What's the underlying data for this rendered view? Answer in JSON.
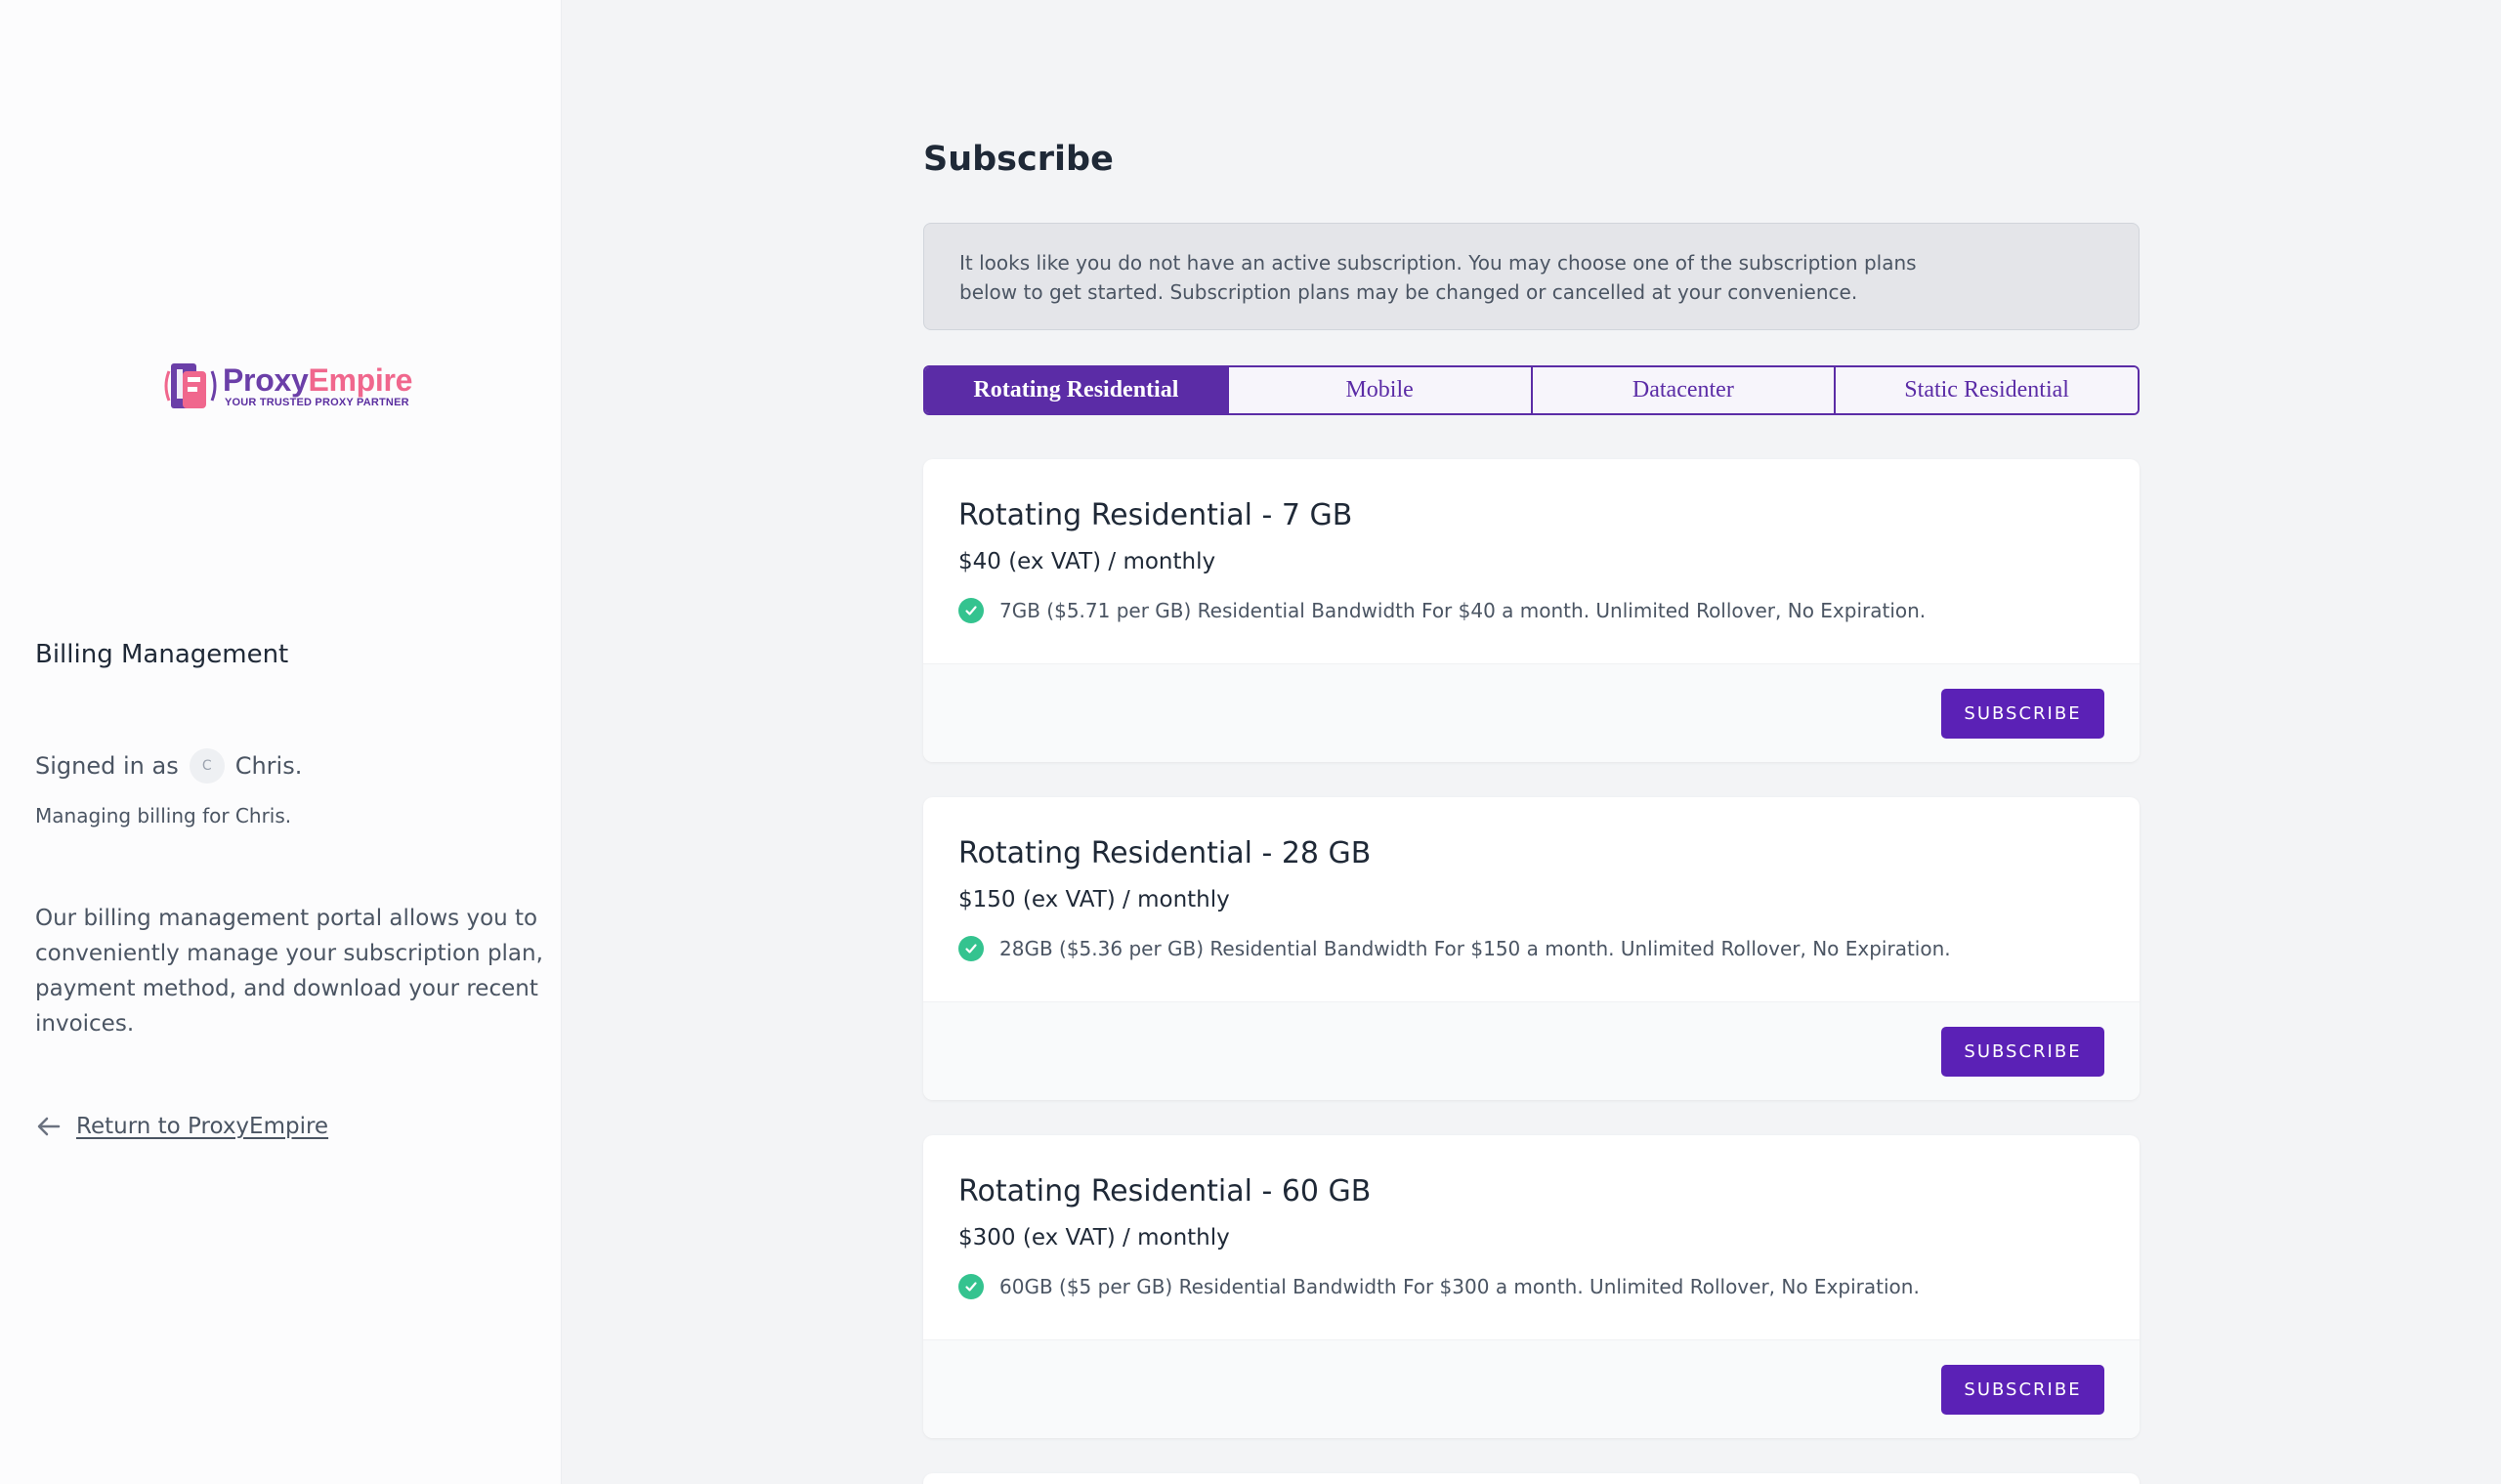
{
  "sidebar": {
    "logo": {
      "name_part1": "Proxy",
      "name_part2": "Empire",
      "tagline": "YOUR TRUSTED PROXY PARTNER"
    },
    "title": "Billing Management",
    "signed_in_prefix": "Signed in as",
    "avatar_initial": "C",
    "user_name": "Chris.",
    "managing": "Managing billing for Chris.",
    "description": "Our billing management portal allows you to conveniently manage your subscription plan, payment method, and download your recent invoices.",
    "return_link": "Return to ProxyEmpire"
  },
  "main": {
    "title": "Subscribe",
    "notice": "It looks like you do not have an active subscription. You may choose one of the subscription plans below to get started. Subscription plans may be changed or cancelled at your convenience.",
    "tabs": [
      {
        "label": "Rotating Residential",
        "active": true
      },
      {
        "label": "Mobile",
        "active": false
      },
      {
        "label": "Datacenter",
        "active": false
      },
      {
        "label": "Static Residential",
        "active": false
      }
    ],
    "plans": [
      {
        "title": "Rotating Residential - 7 GB",
        "price": "$40 (ex VAT) / monthly",
        "feature": "7GB ($5.71 per GB) Residential Bandwidth For $40 a month. Unlimited Rollover, No Expiration.",
        "button": "SUBSCRIBE"
      },
      {
        "title": "Rotating Residential - 28 GB",
        "price": "$150 (ex VAT) / monthly",
        "feature": "28GB ($5.36 per GB) Residential Bandwidth For $150 a month. Unlimited Rollover, No Expiration.",
        "button": "SUBSCRIBE"
      },
      {
        "title": "Rotating Residential - 60 GB",
        "price": "$300 (ex VAT) / monthly",
        "feature": "60GB ($5 per GB) Residential Bandwidth For $300 a month. Unlimited Rollover, No Expiration.",
        "button": "SUBSCRIBE"
      }
    ]
  },
  "colors": {
    "accent": "#5b21b6",
    "check": "#34c38f",
    "brand_pink": "#f0678d"
  }
}
